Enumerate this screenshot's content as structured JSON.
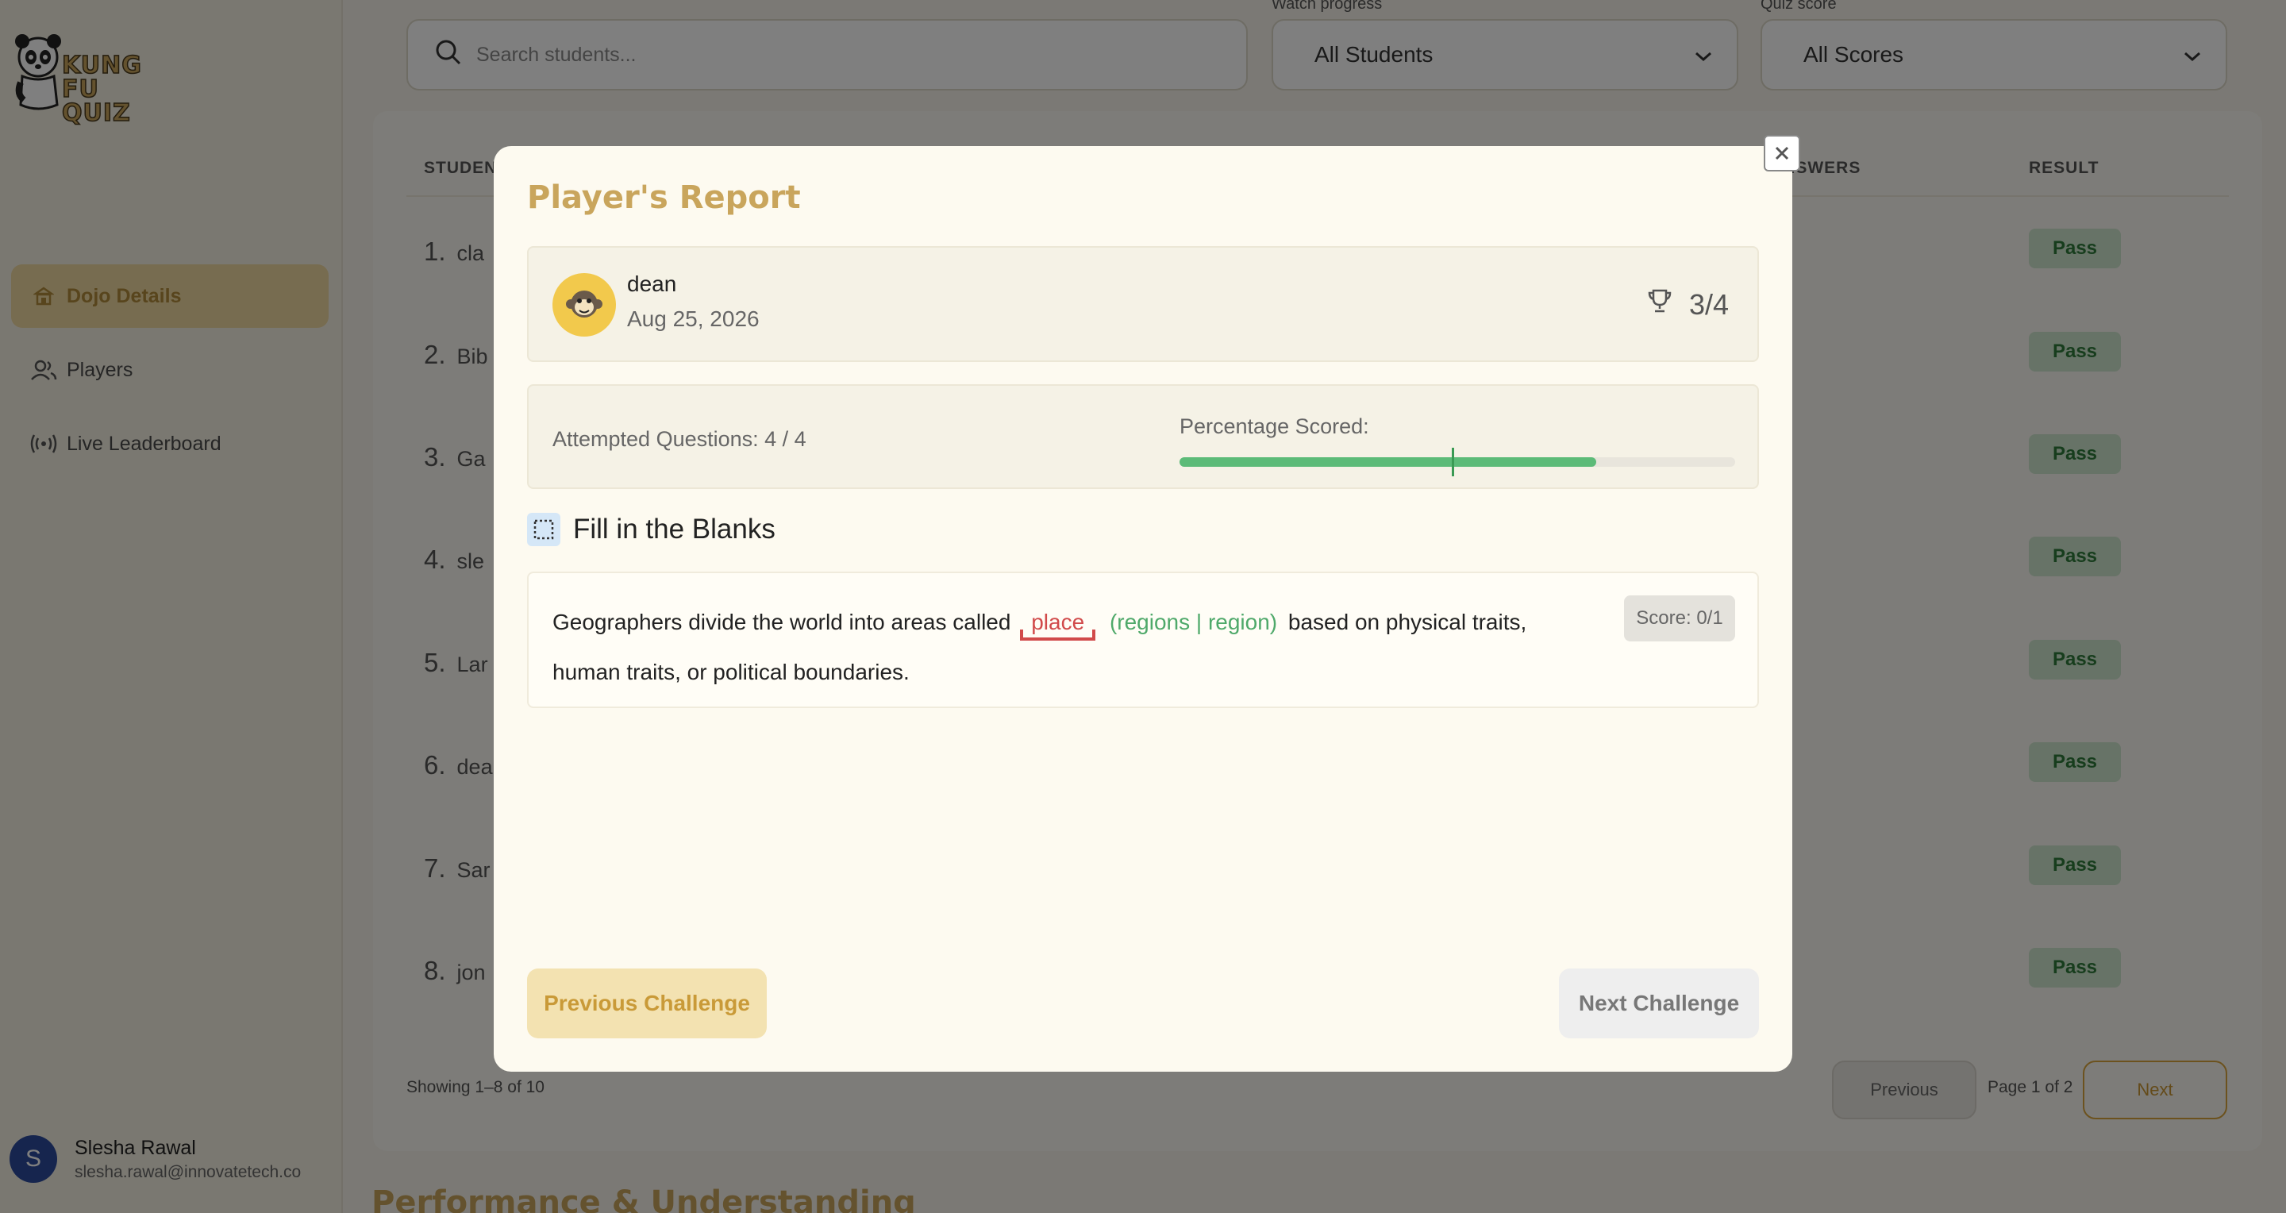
{
  "sidebar": {
    "logo_text": "KUNG FU QUIZ",
    "items": [
      {
        "label": "Dojo Details",
        "icon": "dojo-icon",
        "active": true
      },
      {
        "label": "Players",
        "icon": "users-icon",
        "active": false
      },
      {
        "label": "Live Leaderboard",
        "icon": "broadcast-icon",
        "active": false
      }
    ],
    "user": {
      "initial": "S",
      "name": "Slesha Rawal",
      "email": "slesha.rawal@innovatetech.co"
    }
  },
  "toolbar": {
    "search_placeholder": "Search students...",
    "watch_label": "Watch progress",
    "watch_value": "All Students",
    "quiz_label": "Quiz score",
    "quiz_value": "All Scores"
  },
  "table": {
    "headers": {
      "student": "STUDENT",
      "answers": "ANSWERS",
      "result": "RESULT"
    },
    "rows": [
      {
        "num": "1.",
        "name": "cla",
        "result": "Pass"
      },
      {
        "num": "2.",
        "name": "Bib",
        "result": "Pass"
      },
      {
        "num": "3.",
        "name": "Ga",
        "result": "Pass"
      },
      {
        "num": "4.",
        "name": "sle",
        "result": "Pass"
      },
      {
        "num": "5.",
        "name": "Lar",
        "result": "Pass"
      },
      {
        "num": "6.",
        "name": "dea",
        "result": "Pass"
      },
      {
        "num": "7.",
        "name": "Sar",
        "result": "Pass"
      },
      {
        "num": "8.",
        "name": "jon",
        "result": "Pass"
      }
    ],
    "showing": "Showing 1–8 of 10",
    "prev_label": "Previous",
    "page_info": "Page 1 of 2",
    "next_label": "Next"
  },
  "section_title": "Performance & Understanding",
  "modal": {
    "title": "Player's Report",
    "player": {
      "name": "dean",
      "date": "Aug 25, 2026",
      "score": "3/4"
    },
    "attempted": "Attempted Questions: 4 / 4",
    "pct_label": "Percentage Scored:",
    "pct_value": 0.75,
    "pass_mark": 0.49,
    "question_type": "Fill in the Blanks",
    "question": {
      "before": "Geographers divide the world into areas called",
      "wrong_answer": "place",
      "correct_answer": "(regions | region)",
      "after": "based on physical traits, human traits, or political boundaries.",
      "score": "Score: 0/1"
    },
    "prev_button": "Previous Challenge",
    "next_button": "Next Challenge"
  },
  "colors": {
    "accent": "#c9a55c",
    "pass": "#5cbb78",
    "wrong": "#d14a4a",
    "correct": "#4fa96a"
  }
}
